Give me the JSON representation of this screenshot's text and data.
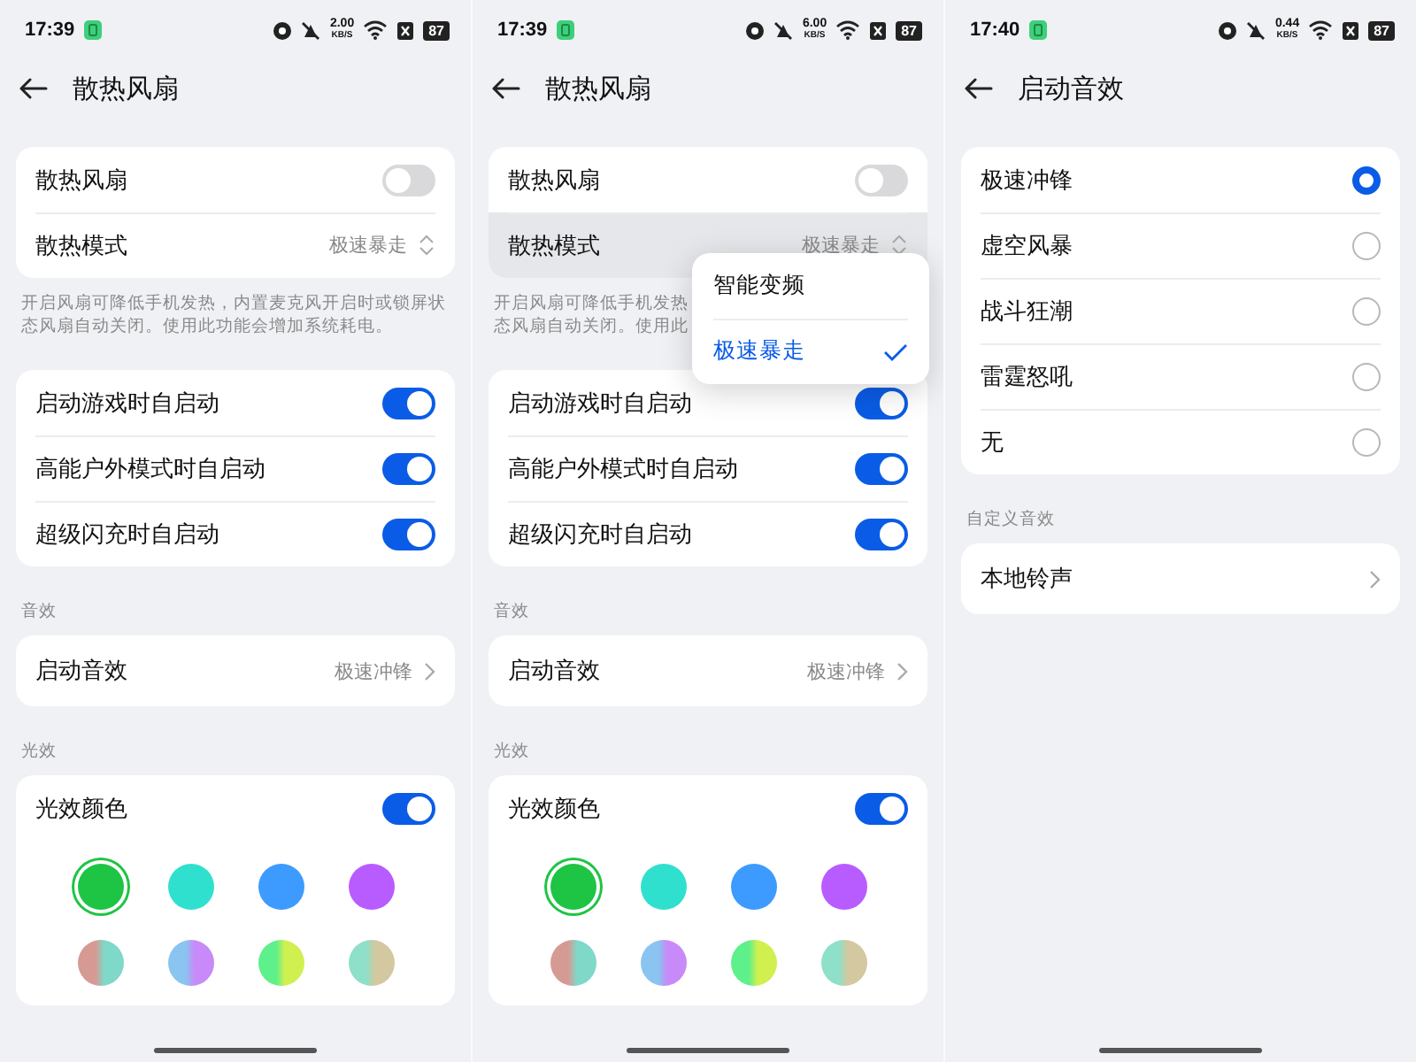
{
  "screens": [
    {
      "status": {
        "time": "17:39",
        "speed": "2.00",
        "speed_unit": "KB/S",
        "battery": "87"
      },
      "title": "散热风扇",
      "sections": [
        {
          "rows": [
            {
              "kind": "toggle",
              "label": "散热风扇",
              "on": false
            },
            {
              "kind": "select",
              "label": "散热模式",
              "value": "极速暴走",
              "pressed": false
            }
          ],
          "note": [
            "开启风扇可降低手机发热，内置麦克风开启时或锁屏状",
            "态风扇自动关闭。使用此功能会增加系统耗电。"
          ]
        },
        {
          "rows": [
            {
              "kind": "toggle",
              "label": "启动游戏时自启动",
              "on": true
            },
            {
              "kind": "toggle",
              "label": "高能户外模式时自启动",
              "on": true
            },
            {
              "kind": "toggle",
              "label": "超级闪充时自启动",
              "on": true
            }
          ]
        },
        {
          "header": "音效",
          "rows": [
            {
              "kind": "link",
              "label": "启动音效",
              "value": "极速冲锋"
            }
          ]
        },
        {
          "header": "光效",
          "rows": [
            {
              "kind": "toggle",
              "label": "光效颜色",
              "on": true
            },
            {
              "kind": "swatches",
              "swatches": [
                {
                  "color": "#1ec444",
                  "selected": true
                },
                {
                  "color": "#2fe0cf",
                  "selected": false
                },
                {
                  "color": "#3d9bff",
                  "selected": false
                },
                {
                  "color": "#b85cff",
                  "selected": false
                },
                {
                  "stops": [
                    {
                      "color": "#d69a94"
                    },
                    {
                      "color": "#7fd8c8"
                    }
                  ],
                  "selected": false
                },
                {
                  "stops": [
                    {
                      "color": "#8ac4f0"
                    },
                    {
                      "color": "#c88af8"
                    }
                  ],
                  "selected": false
                },
                {
                  "stops": [
                    {
                      "color": "#5ef08a"
                    },
                    {
                      "color": "#d0f050"
                    }
                  ],
                  "selected": false
                },
                {
                  "stops": [
                    {
                      "color": "#8ee0c8"
                    },
                    {
                      "color": "#d4c8a0"
                    }
                  ],
                  "selected": false
                }
              ]
            }
          ]
        }
      ]
    },
    {
      "status": {
        "time": "17:39",
        "speed": "6.00",
        "speed_unit": "KB/S",
        "battery": "87"
      },
      "title": "散热风扇",
      "sections": [
        {
          "rows": [
            {
              "kind": "toggle",
              "label": "散热风扇",
              "on": false
            },
            {
              "kind": "select",
              "label": "散热模式",
              "value": "极速暴走",
              "pressed": true
            }
          ],
          "note": [
            "开启风扇可降低手机发热",
            "态风扇自动关闭。使用此"
          ]
        },
        {
          "rows": [
            {
              "kind": "toggle",
              "label": "启动游戏时自启动",
              "on": true
            },
            {
              "kind": "toggle",
              "label": "高能户外模式时自启动",
              "on": true
            },
            {
              "kind": "toggle",
              "label": "超级闪充时自启动",
              "on": true
            }
          ]
        },
        {
          "header": "音效",
          "rows": [
            {
              "kind": "link",
              "label": "启动音效",
              "value": "极速冲锋"
            }
          ]
        },
        {
          "header": "光效",
          "rows": [
            {
              "kind": "toggle",
              "label": "光效颜色",
              "on": true
            },
            {
              "kind": "swatches",
              "swatches": [
                {
                  "color": "#1ec444",
                  "selected": true
                },
                {
                  "color": "#2fe0cf",
                  "selected": false
                },
                {
                  "color": "#3d9bff",
                  "selected": false
                },
                {
                  "color": "#b85cff",
                  "selected": false
                },
                {
                  "stops": [
                    {
                      "color": "#d69a94"
                    },
                    {
                      "color": "#7fd8c8"
                    }
                  ],
                  "selected": false
                },
                {
                  "stops": [
                    {
                      "color": "#8ac4f0"
                    },
                    {
                      "color": "#c88af8"
                    }
                  ],
                  "selected": false
                },
                {
                  "stops": [
                    {
                      "color": "#5ef08a"
                    },
                    {
                      "color": "#d0f050"
                    }
                  ],
                  "selected": false
                },
                {
                  "stops": [
                    {
                      "color": "#8ee0c8"
                    },
                    {
                      "color": "#d4c8a0"
                    }
                  ],
                  "selected": false
                }
              ]
            }
          ]
        }
      ],
      "popup": {
        "items": [
          {
            "label": "智能变频",
            "selected": false
          },
          {
            "label": "极速暴走",
            "selected": true
          }
        ]
      }
    },
    {
      "status": {
        "time": "17:40",
        "speed": "0.44",
        "speed_unit": "KB/S",
        "battery": "87"
      },
      "title": "启动音效",
      "sections": [
        {
          "rows": [
            {
              "kind": "radio",
              "label": "极速冲锋",
              "selected": true
            },
            {
              "kind": "radio",
              "label": "虚空风暴",
              "selected": false
            },
            {
              "kind": "radio",
              "label": "战斗狂潮",
              "selected": false
            },
            {
              "kind": "radio",
              "label": "雷霆怒吼",
              "selected": false
            },
            {
              "kind": "radio",
              "label": "无",
              "selected": false
            }
          ]
        },
        {
          "header": "自定义音效",
          "rows": [
            {
              "kind": "link",
              "label": "本地铃声"
            }
          ]
        }
      ]
    }
  ]
}
